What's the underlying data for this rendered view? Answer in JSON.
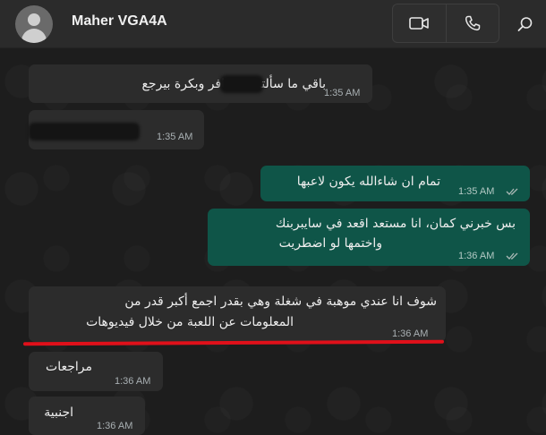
{
  "header": {
    "contact_name": "Maher VGA4A",
    "avatar_icon": "default-avatar-icon",
    "actions": [
      {
        "name": "video-call",
        "icon": "video-camera-icon"
      },
      {
        "name": "voice-call",
        "icon": "phone-icon"
      },
      {
        "name": "search",
        "icon": "search-icon"
      }
    ]
  },
  "colors": {
    "incoming_bubble": "#2c2c2c",
    "outgoing_bubble": "#0f5548",
    "highlight_underline": "#e0101a",
    "header": "#2b2b2b"
  },
  "messages": [
    {
      "direction": "incoming",
      "text": "باقي ما سألته.. مسافر وبكرة بيرجع",
      "time": "1:35 AM",
      "partially_redacted": true
    },
    {
      "direction": "incoming",
      "text": "",
      "time": "1:35 AM",
      "redacted": true
    },
    {
      "direction": "outgoing",
      "text": "تمام ان شاءالله يكون لاعبها",
      "time": "1:35 AM",
      "status": "read"
    },
    {
      "direction": "outgoing",
      "line1": "بس خبرني كمان، انا مستعد اقعد في سايبربنك",
      "line2": "واختمها لو اضطريت",
      "time": "1:36 AM",
      "status": "read"
    },
    {
      "direction": "incoming",
      "line1": "شوف انا عندي موهبة في شغلة وهي بقدر اجمع أكبر قدر من",
      "line2": "المعلومات عن اللعبة من خلال فيديوهات",
      "time": "1:36 AM",
      "highlighted": true
    },
    {
      "direction": "incoming",
      "text": "مراجعات",
      "time": "1:36 AM"
    },
    {
      "direction": "incoming",
      "text": "اجنبية",
      "time": "1:36 AM"
    }
  ]
}
